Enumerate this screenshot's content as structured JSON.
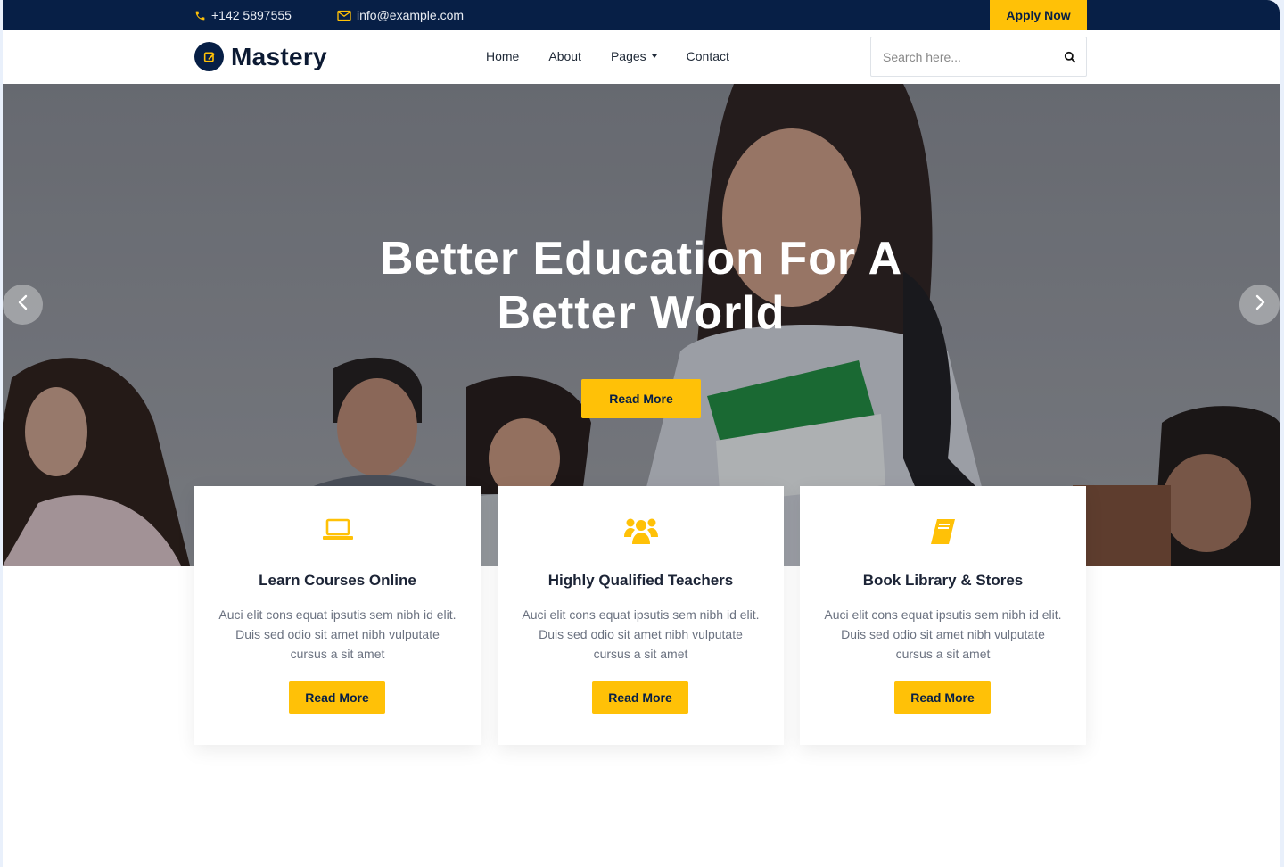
{
  "topbar": {
    "phone": "+142 5897555",
    "email": "info@example.com",
    "apply_label": "Apply Now"
  },
  "brand": {
    "name": "Mastery"
  },
  "nav": {
    "home": "Home",
    "about": "About",
    "pages": "Pages",
    "contact": "Contact"
  },
  "search": {
    "placeholder": "Search here..."
  },
  "hero": {
    "title_line1": "Better Education For A",
    "title_line2": "Better World",
    "button_label": "Read More"
  },
  "features": [
    {
      "icon": "laptop-icon",
      "title": "Learn Courses Online",
      "text": "Auci elit cons equat ipsutis sem nibh id elit. Duis sed odio sit amet nibh vulputate cursus a sit amet",
      "button_label": "Read More"
    },
    {
      "icon": "users-icon",
      "title": "Highly Qualified Teachers",
      "text": "Auci elit cons equat ipsutis sem nibh id elit. Duis sed odio sit amet nibh vulputate cursus a sit amet",
      "button_label": "Read More"
    },
    {
      "icon": "book-icon",
      "title": "Book Library & Stores",
      "text": "Auci elit cons equat ipsutis sem nibh id elit. Duis sed odio sit amet nibh vulputate cursus a sit amet",
      "button_label": "Read More"
    }
  ],
  "colors": {
    "navy": "#071f46",
    "accent": "#ffc107"
  }
}
